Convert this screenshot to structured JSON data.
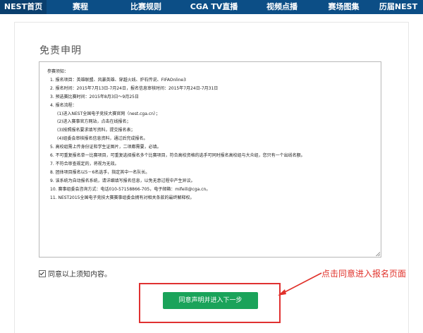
{
  "nav": {
    "items": [
      "NEST首页",
      "赛程",
      "比赛规则",
      "CGA TV直播",
      "视频点播",
      "赛场图集",
      "历届NEST"
    ],
    "active_index": 0
  },
  "page": {
    "title": "免责申明"
  },
  "notice": {
    "lines": [
      {
        "text": "参赛须知：",
        "level": 0
      },
      {
        "text": "1.   报名项目：英雄联盟、风暴英雄、穿越火线、炉石传说、FIFAOnline3",
        "level": 1
      },
      {
        "text": "2.   报名时间：2015年7月13日-7月24日，报名信息审核时间：2015年7月24日-7月31日",
        "level": 1
      },
      {
        "text": "3.   预选赛比赛时间：2015年8月3日～9月25日",
        "level": 1
      },
      {
        "text": "4.   报名流程：",
        "level": 1
      },
      {
        "text": "(1)进入NEST全国电子竞技大赛官网（nest.cga.cn）；",
        "level": 2
      },
      {
        "text": "(2)进入赛事官方网站，点击在线报名；",
        "level": 2
      },
      {
        "text": "(3)按照报名要求填写资料，提交报名表；",
        "level": 2
      },
      {
        "text": "(4)组委会审核报名信息资料，通过后完成报名。",
        "level": 2
      },
      {
        "text": "5.   高校组需上传身份证和学生证图片，二项都需要，必填。",
        "level": 1
      },
      {
        "text": "6.   不可重复报名单一比赛项目，可重复选择报名多个比赛项目，符合高校资格的选手可同时报名高校组与大众组，您只有一个出线名额。",
        "level": 1
      },
      {
        "text": "7.   不符合审查规定的，将视为无效。",
        "level": 1
      },
      {
        "text": "8.   团体项目报名以5－6名选手，指定其中一名队长。",
        "level": 1
      },
      {
        "text": "9.   该系统为自动报名系统，请详细填写报名信息，以免无意过程中产生异议。",
        "level": 1
      },
      {
        "text": "10.  赛事组委会咨询方式：电话010-57158866-705，电子邮箱：mifeili@cga.cn。",
        "level": 1
      },
      {
        "text": "11.  NEST2015全国电子竞技大赛赛事组委会拥有对相关条款的最终解释权。",
        "level": 1
      }
    ]
  },
  "agree": {
    "label": "同意以上须知内容。",
    "checked": true
  },
  "submit": {
    "label": "同意声明并进入下一步"
  },
  "annotation": {
    "text": "点击同意进入报名页面",
    "color": "#e0312a"
  },
  "colors": {
    "nav_bg": "#0c4e86",
    "button_bg": "#1aa35a",
    "highlight": "#e03131"
  }
}
